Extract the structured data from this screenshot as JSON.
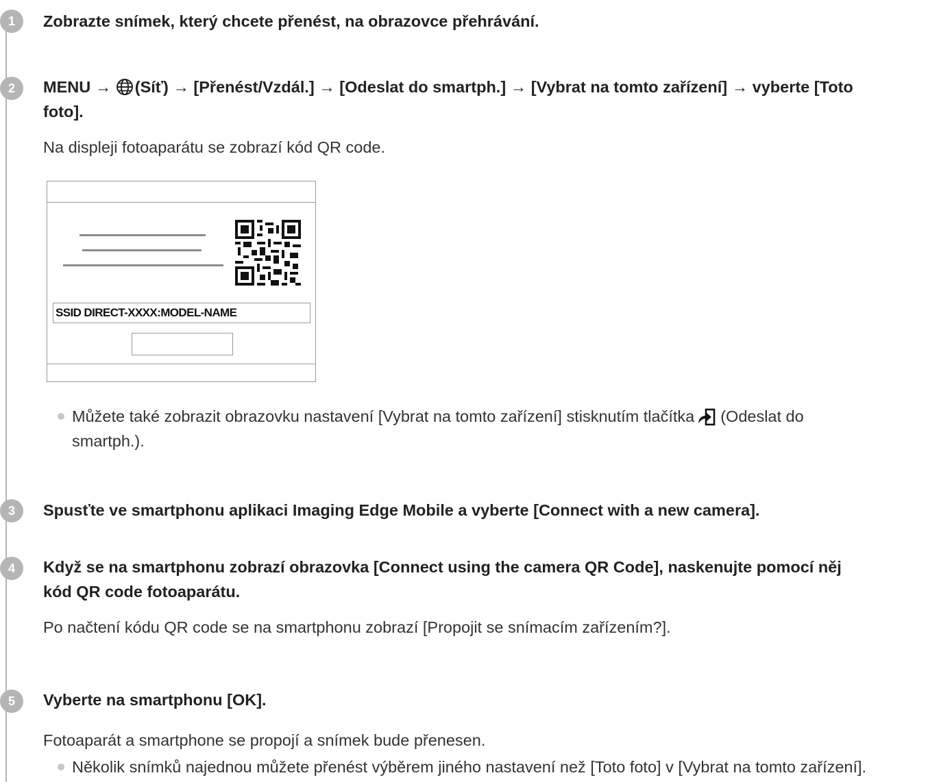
{
  "steps": [
    {
      "number": "1",
      "title": "Zobrazte snímek, který chcete přenést, na obrazovce přehrávání."
    },
    {
      "number": "2",
      "title_parts": {
        "menu": "MENU →",
        "network": "(Síť) → [Přenést/Vzdál.] → [Odeslat do smartph.] → [Vybrat na tomto zařízení] → vyberte [Toto",
        "end": "foto]."
      },
      "description": "Na displeji fotoaparátu se zobrazí kód QR code.",
      "illustration": {
        "ssid_text": "SSID DIRECT-XXXX:MODEL-NAME"
      },
      "note": {
        "before": "Můžete také zobrazit obrazovku nastavení [Vybrat na tomto zařízení] stisknutím tlačítka",
        "after": "(Odeslat do",
        "line2": "smartph.)."
      }
    },
    {
      "number": "3",
      "title": "Spusťte ve smartphonu aplikaci Imaging Edge Mobile a vyberte [Connect with a new camera]."
    },
    {
      "number": "4",
      "title_line1": "Když se na smartphonu zobrazí obrazovka [Connect using the camera QR Code], naskenujte pomocí něj",
      "title_line2": "kód QR code fotoaparátu.",
      "description": "Po načtení kódu QR code se na smartphonu zobrazí [Propojit se snímacím zařízením?]."
    },
    {
      "number": "5",
      "title": "Vyberte na smartphonu [OK].",
      "description": "Fotoaparát a smartphone se propojí a snímek bude přenesen.",
      "note": "Několik snímků najednou můžete přenést výběrem jiného nastavení než [Toto foto] v [Vybrat na tomto zařízení]."
    }
  ],
  "icons": [
    "globe-icon",
    "send-to-smartphone-icon",
    "qr-code-icon"
  ],
  "colors": {
    "step_badge": "#b5b5b5",
    "timeline": "#b3b3b3",
    "text": "#222222"
  }
}
